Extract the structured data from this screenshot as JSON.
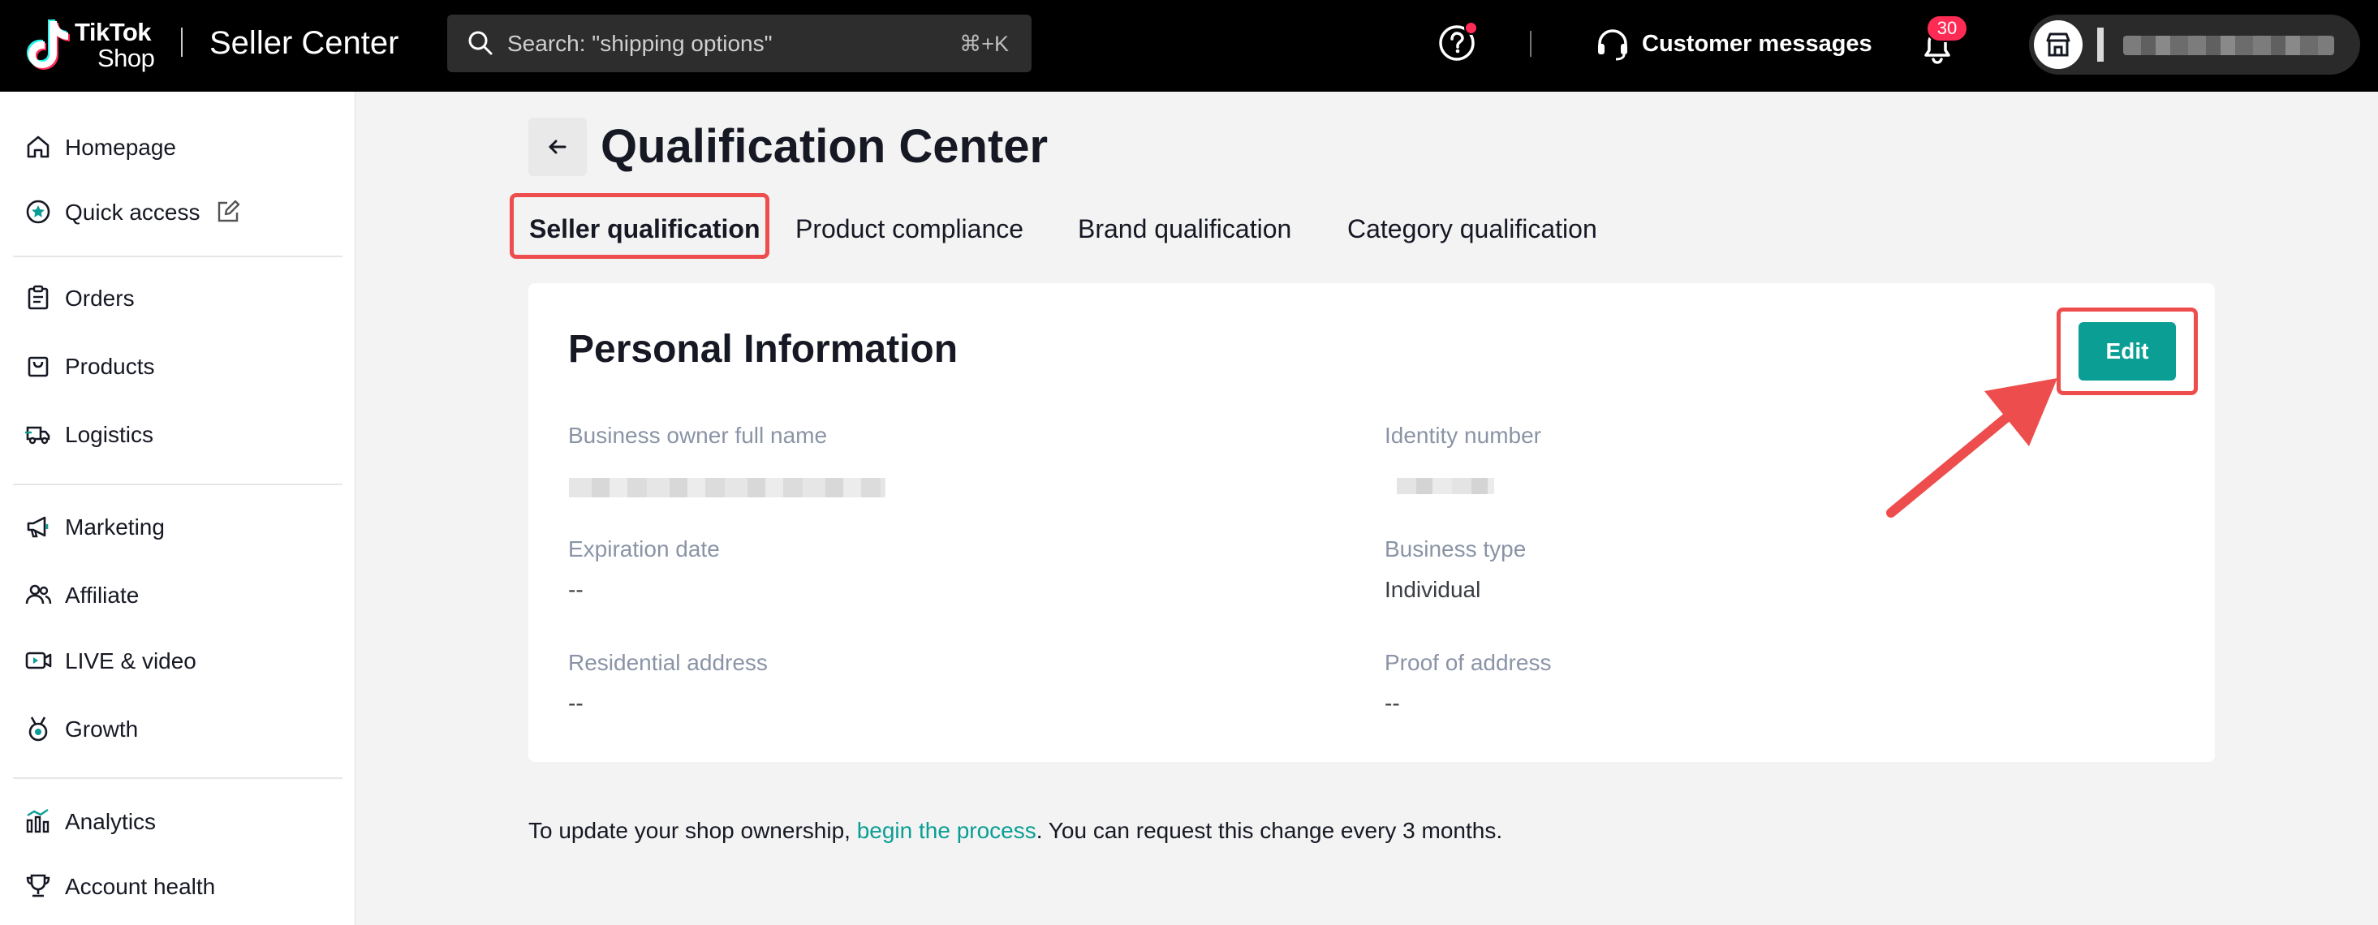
{
  "brand": {
    "logo_line1": "TikTok",
    "logo_line2": "Shop",
    "app_name": "Seller Center"
  },
  "search": {
    "placeholder": "Search: \"shipping options\"",
    "shortcut": "⌘+K",
    "icon": "search-icon"
  },
  "header": {
    "help_icon": "help-icon",
    "customer_messages": "Customer messages",
    "notifications_count": "30",
    "notification_icon": "bell-icon"
  },
  "sidebar": {
    "items": [
      {
        "label": "Homepage",
        "icon": "home-icon"
      },
      {
        "label": "Quick access",
        "icon": "star-circle-icon"
      },
      {
        "label": "Orders",
        "icon": "clipboard-icon"
      },
      {
        "label": "Products",
        "icon": "bag-icon"
      },
      {
        "label": "Logistics",
        "icon": "truck-icon"
      },
      {
        "label": "Marketing",
        "icon": "megaphone-icon"
      },
      {
        "label": "Affiliate",
        "icon": "users-icon"
      },
      {
        "label": "LIVE & video",
        "icon": "video-icon"
      },
      {
        "label": "Growth",
        "icon": "medal-icon"
      },
      {
        "label": "Analytics",
        "icon": "bar-chart-icon"
      },
      {
        "label": "Account health",
        "icon": "trophy-icon"
      }
    ]
  },
  "page": {
    "title": "Qualification Center",
    "tabs": [
      {
        "label": "Seller qualification",
        "active": true
      },
      {
        "label": "Product compliance",
        "active": false
      },
      {
        "label": "Brand qualification",
        "active": false
      },
      {
        "label": "Category qualification",
        "active": false
      }
    ]
  },
  "card": {
    "title": "Personal Information",
    "edit_label": "Edit",
    "fields": [
      {
        "label": "Business owner full name",
        "value": ""
      },
      {
        "label": "Identity number",
        "value": ""
      },
      {
        "label": "Expiration date",
        "value": "--"
      },
      {
        "label": "Business type",
        "value": "Individual"
      },
      {
        "label": "Residential address",
        "value": "--"
      },
      {
        "label": "Proof of address",
        "value": "--"
      }
    ]
  },
  "footer_note": {
    "before": "To update your shop ownership, ",
    "link": "begin the process",
    "after": ". You can request this change every 3 months."
  },
  "colors": {
    "accent": "#0a9e95",
    "highlight": "#ee4d4d",
    "badge": "#fe2c55"
  }
}
